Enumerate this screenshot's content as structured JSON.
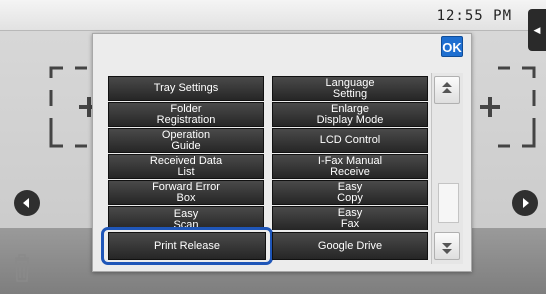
{
  "status_bar": {
    "time": "12:55 PM"
  },
  "dialog": {
    "ok_label": "OK",
    "buttons": [
      "Tray Settings",
      "Language\nSetting",
      "Folder\nRegistration",
      "Enlarge\nDisplay Mode",
      "Operation\nGuide",
      "LCD Control",
      "Received Data\nList",
      "I-Fax Manual\nReceive",
      "Forward Error\nBox",
      "Easy\nCopy",
      "Easy\nScan",
      "Easy\nFax"
    ],
    "selected_label": "Print Release",
    "other_label": "Google Drive"
  }
}
